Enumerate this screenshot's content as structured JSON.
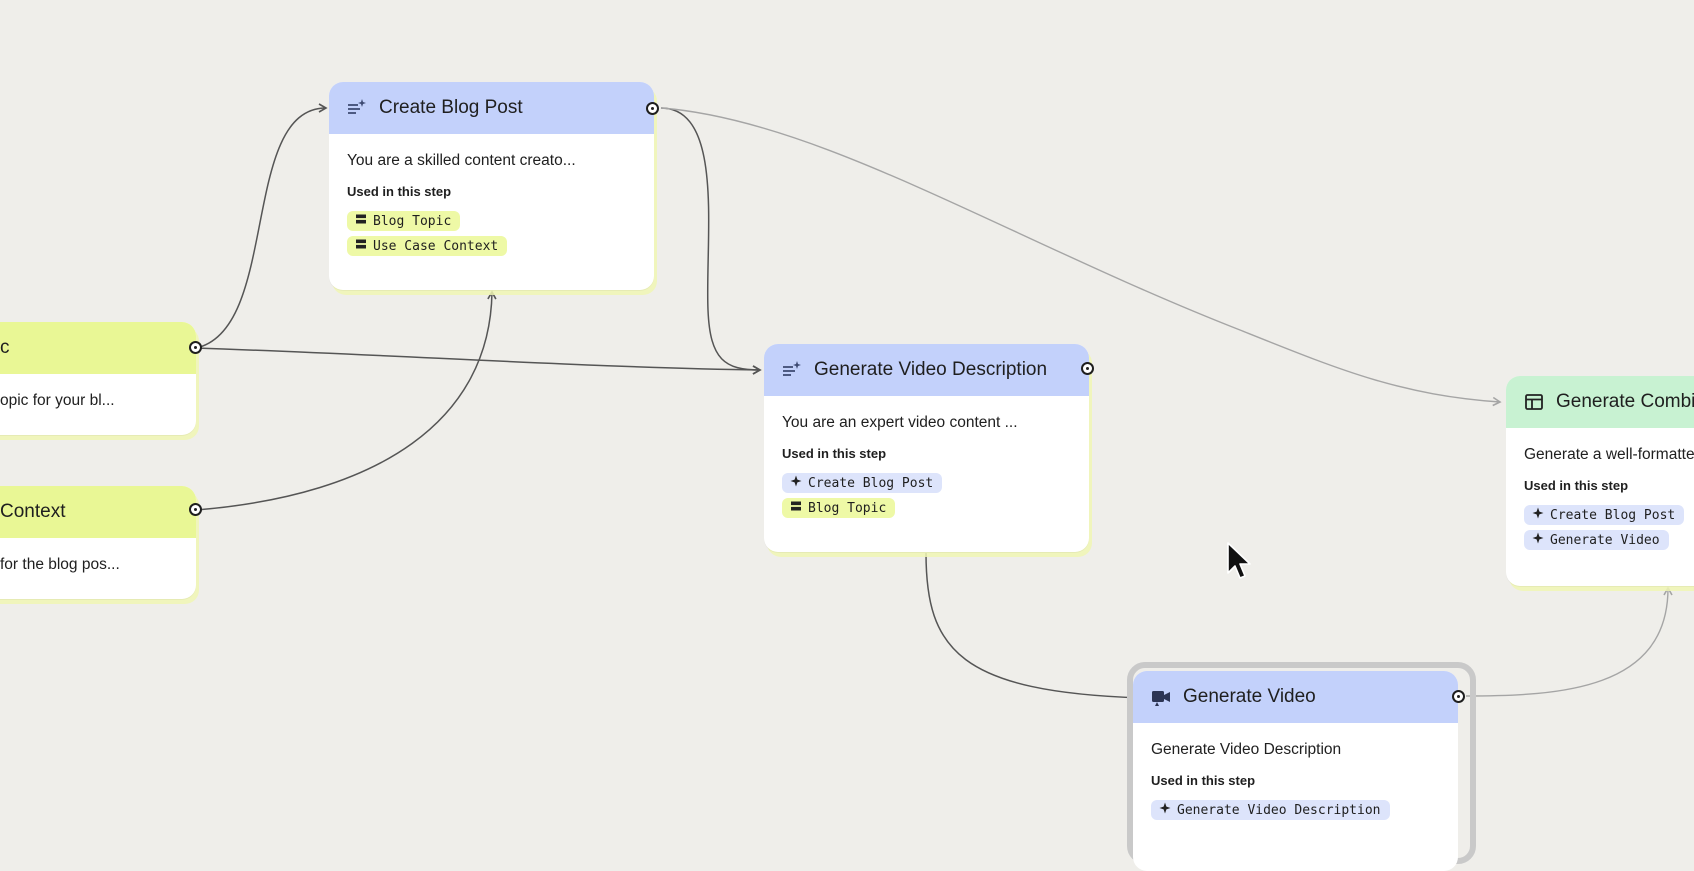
{
  "nodes": {
    "blog_topic": {
      "title": "Blog Topic",
      "title_visible": "c",
      "description": "opic for your bl...",
      "icon": "input-icon"
    },
    "use_case_context": {
      "title": "Context",
      "description": "for the blog pos...",
      "icon": "input-icon"
    },
    "create_blog_post": {
      "title": "Create Blog Post",
      "description": "You are a skilled content creato...",
      "used_label": "Used in this step",
      "chips": [
        "Blog Topic",
        "Use Case Context"
      ],
      "icon": "text-sparkle-icon"
    },
    "generate_video_description": {
      "title": "Generate Video Description",
      "description": "You are an expert video content ...",
      "used_label": "Used in this step",
      "chips": [
        "Create Blog Post",
        "Blog Topic"
      ],
      "icon": "text-sparkle-icon"
    },
    "generate_combined": {
      "title": "Generate Combi",
      "description": "Generate a well-formatte",
      "used_label": "Used in this step",
      "chips": [
        "Create Blog Post",
        "Generate Video"
      ],
      "icon": "layout-icon"
    },
    "generate_video": {
      "title": "Generate Video",
      "description": "Generate Video Description",
      "used_label": "Used in this step",
      "chips": [
        "Generate Video Description"
      ],
      "icon": "video-icon"
    }
  },
  "colors": {
    "canvas": "#efeeea",
    "header_blue": "#c3d1fb",
    "header_yellow": "#e9f795",
    "header_green": "#c8f2d2",
    "chip_yellow": "#eef9a6",
    "chip_blue": "#dde4fb"
  }
}
